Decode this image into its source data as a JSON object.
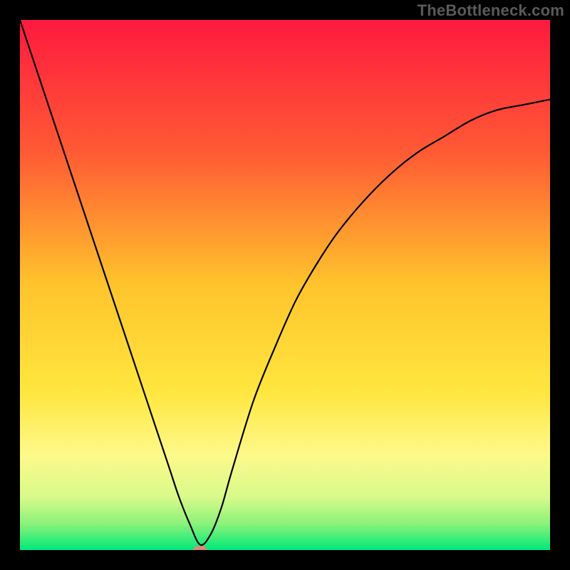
{
  "watermark": "TheBottleneck.com",
  "chart_data": {
    "type": "line",
    "title": "",
    "xlabel": "",
    "ylabel": "",
    "xlim": [
      0,
      100
    ],
    "ylim": [
      0,
      100
    ],
    "grid": false,
    "legend": false,
    "background_gradient": {
      "stops": [
        {
          "pos": 0.0,
          "color": "#ff1a3f"
        },
        {
          "pos": 0.25,
          "color": "#ff5a34"
        },
        {
          "pos": 0.5,
          "color": "#ffc42c"
        },
        {
          "pos": 0.7,
          "color": "#ffe63e"
        },
        {
          "pos": 0.82,
          "color": "#fdf98a"
        },
        {
          "pos": 0.9,
          "color": "#d8fa8a"
        },
        {
          "pos": 0.95,
          "color": "#8cf27a"
        },
        {
          "pos": 1.0,
          "color": "#00e97a"
        }
      ]
    },
    "series": [
      {
        "name": "bottleneck-curve",
        "stroke": "#000000",
        "x": [
          0,
          4,
          8,
          12,
          16,
          20,
          24,
          28,
          30,
          32,
          34,
          36,
          38,
          40,
          44,
          48,
          52,
          56,
          60,
          65,
          70,
          75,
          80,
          85,
          90,
          95,
          100
        ],
        "y": [
          100,
          88,
          76,
          64,
          52,
          40,
          28,
          16,
          10,
          5,
          1,
          3,
          8,
          15,
          28,
          38,
          47,
          54,
          60,
          66,
          71,
          75,
          78,
          81,
          83,
          84,
          85
        ]
      }
    ],
    "marker": {
      "name": "optimum-marker",
      "x": 34,
      "y": 0,
      "rx": 10,
      "ry": 6,
      "color": "#d98b80"
    }
  }
}
